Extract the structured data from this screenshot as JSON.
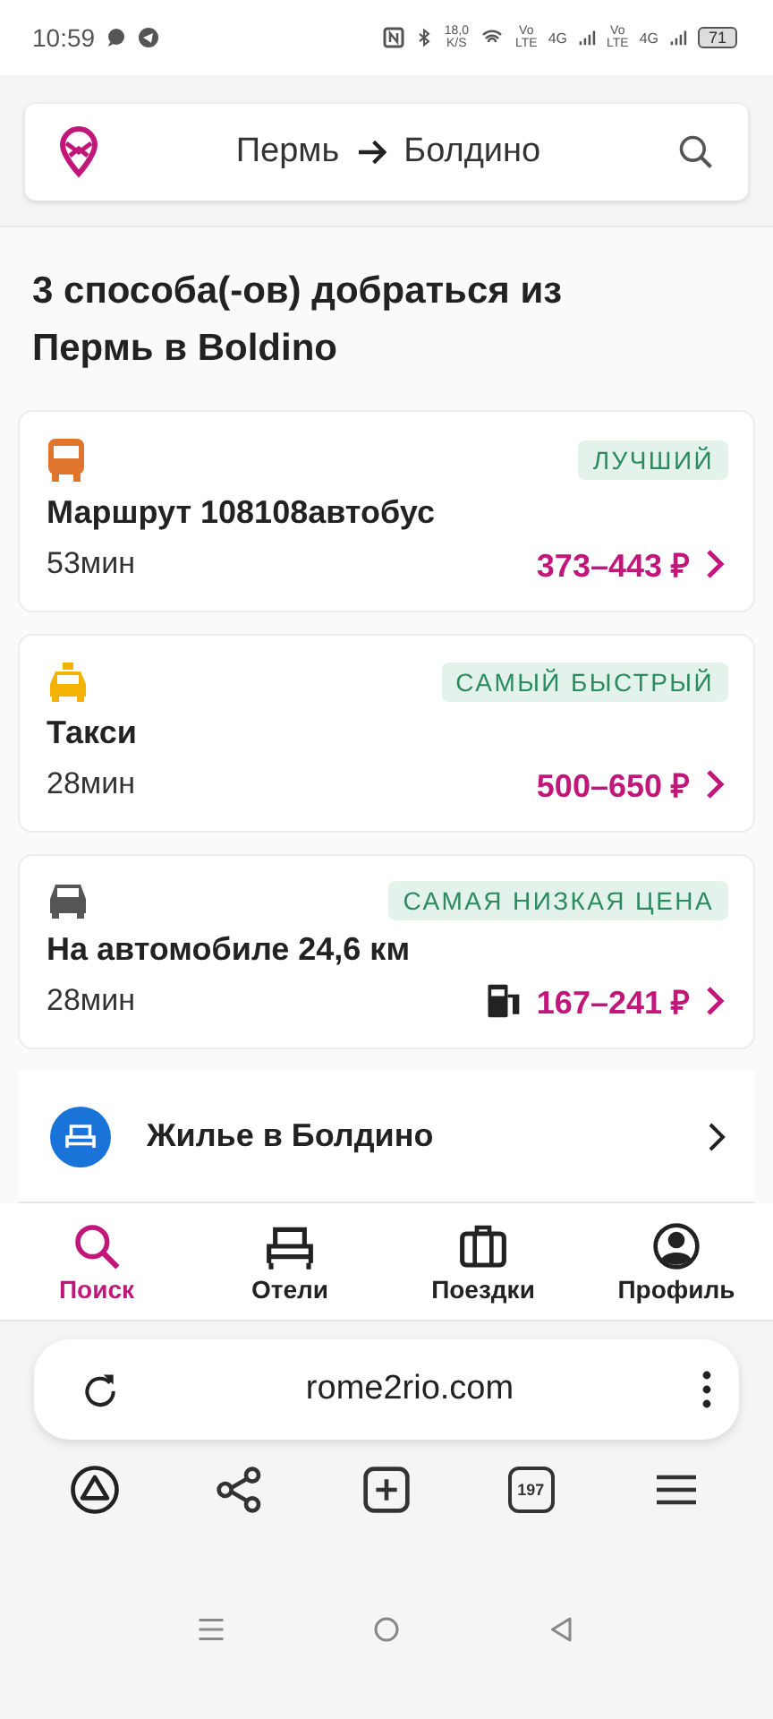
{
  "status_bar": {
    "time": "10:59",
    "speed": "18,0",
    "speed_unit": "K/S",
    "networks": [
      {
        "top": "Vo",
        "bottom": "LTE",
        "gen": "4G"
      },
      {
        "top": "Vo",
        "bottom": "LTE",
        "gen": "4G"
      }
    ],
    "battery": "71"
  },
  "header": {
    "from": "Пермь",
    "to": "Болдино"
  },
  "title": "3 способа(-ов) добраться из Пермь в Boldino",
  "routes": [
    {
      "kind": "bus",
      "badge": "ЛУЧШИЙ",
      "name": "Маршрут 108108автобус",
      "duration": "53мин",
      "price": "373–443 ₽",
      "fuel": false
    },
    {
      "kind": "taxi",
      "badge": "САМЫЙ БЫСТРЫЙ",
      "name": "Такси",
      "duration": "28мин",
      "price": "500–650 ₽",
      "fuel": false
    },
    {
      "kind": "car",
      "badge": "САМАЯ НИЗКАЯ ЦЕНА",
      "name": "На автомобиле 24,6 км",
      "duration": "28мин",
      "price": "167–241 ₽",
      "fuel": true
    }
  ],
  "hotels": {
    "label": "Жилье в Болдино"
  },
  "bottom_nav": [
    {
      "kind": "search",
      "label": "Поиск",
      "selected": true
    },
    {
      "kind": "hotels",
      "label": "Отели",
      "selected": false
    },
    {
      "kind": "trips",
      "label": "Поездки",
      "selected": false
    },
    {
      "kind": "profile",
      "label": "Профиль",
      "selected": false
    }
  ],
  "browser": {
    "url": "rome2rio.com",
    "tabs_count": "197"
  }
}
